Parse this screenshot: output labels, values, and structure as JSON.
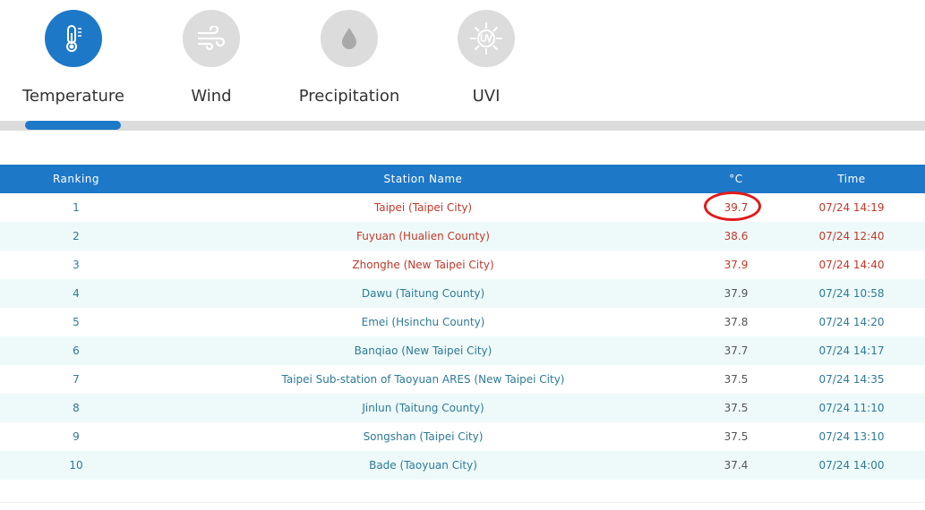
{
  "tabs": [
    {
      "label": "Temperature",
      "icon": "thermometer-icon",
      "active": true
    },
    {
      "label": "Wind",
      "icon": "wind-icon",
      "active": false
    },
    {
      "label": "Precipitation",
      "icon": "raindrop-icon",
      "active": false
    },
    {
      "label": "UVI",
      "icon": "uv-sun-icon",
      "active": false
    }
  ],
  "table": {
    "headers": {
      "rank": "Ranking",
      "station": "Station Name",
      "temp_unit": "°C",
      "time": "Time"
    },
    "rows": [
      {
        "rank": "1",
        "station": "Taipei (Taipei City)",
        "temp": "39.7",
        "time": "07/24 14:19",
        "highlight": true,
        "circled": true
      },
      {
        "rank": "2",
        "station": "Fuyuan (Hualien County)",
        "temp": "38.6",
        "time": "07/24 12:40",
        "highlight": true
      },
      {
        "rank": "3",
        "station": "Zhonghe (New Taipei City)",
        "temp": "37.9",
        "time": "07/24 14:40",
        "highlight": true
      },
      {
        "rank": "4",
        "station": "Dawu (Taitung County)",
        "temp": "37.9",
        "time": "07/24 10:58",
        "highlight": false
      },
      {
        "rank": "5",
        "station": "Emei (Hsinchu County)",
        "temp": "37.8",
        "time": "07/24 14:20",
        "highlight": false
      },
      {
        "rank": "6",
        "station": "Banqiao (New Taipei City)",
        "temp": "37.7",
        "time": "07/24 14:17",
        "highlight": false
      },
      {
        "rank": "7",
        "station": "Taipei Sub-station of Taoyuan ARES (New Taipei City)",
        "temp": "37.5",
        "time": "07/24 14:35",
        "highlight": false
      },
      {
        "rank": "8",
        "station": "Jinlun (Taitung County)",
        "temp": "37.5",
        "time": "07/24 11:10",
        "highlight": false
      },
      {
        "rank": "9",
        "station": "Songshan (Taipei City)",
        "temp": "37.5",
        "time": "07/24 13:10",
        "highlight": false
      },
      {
        "rank": "10",
        "station": "Bade (Taoyuan City)",
        "temp": "37.4",
        "time": "07/24 14:00",
        "highlight": false
      }
    ]
  },
  "colors": {
    "accent": "#1e78c8",
    "inactive_circle": "#dcdcdc",
    "highlight_text": "#c0392b",
    "normal_text": "#2e7a97",
    "annotation_circle": "#e01b1b",
    "striped_row": "#eefaf9"
  }
}
